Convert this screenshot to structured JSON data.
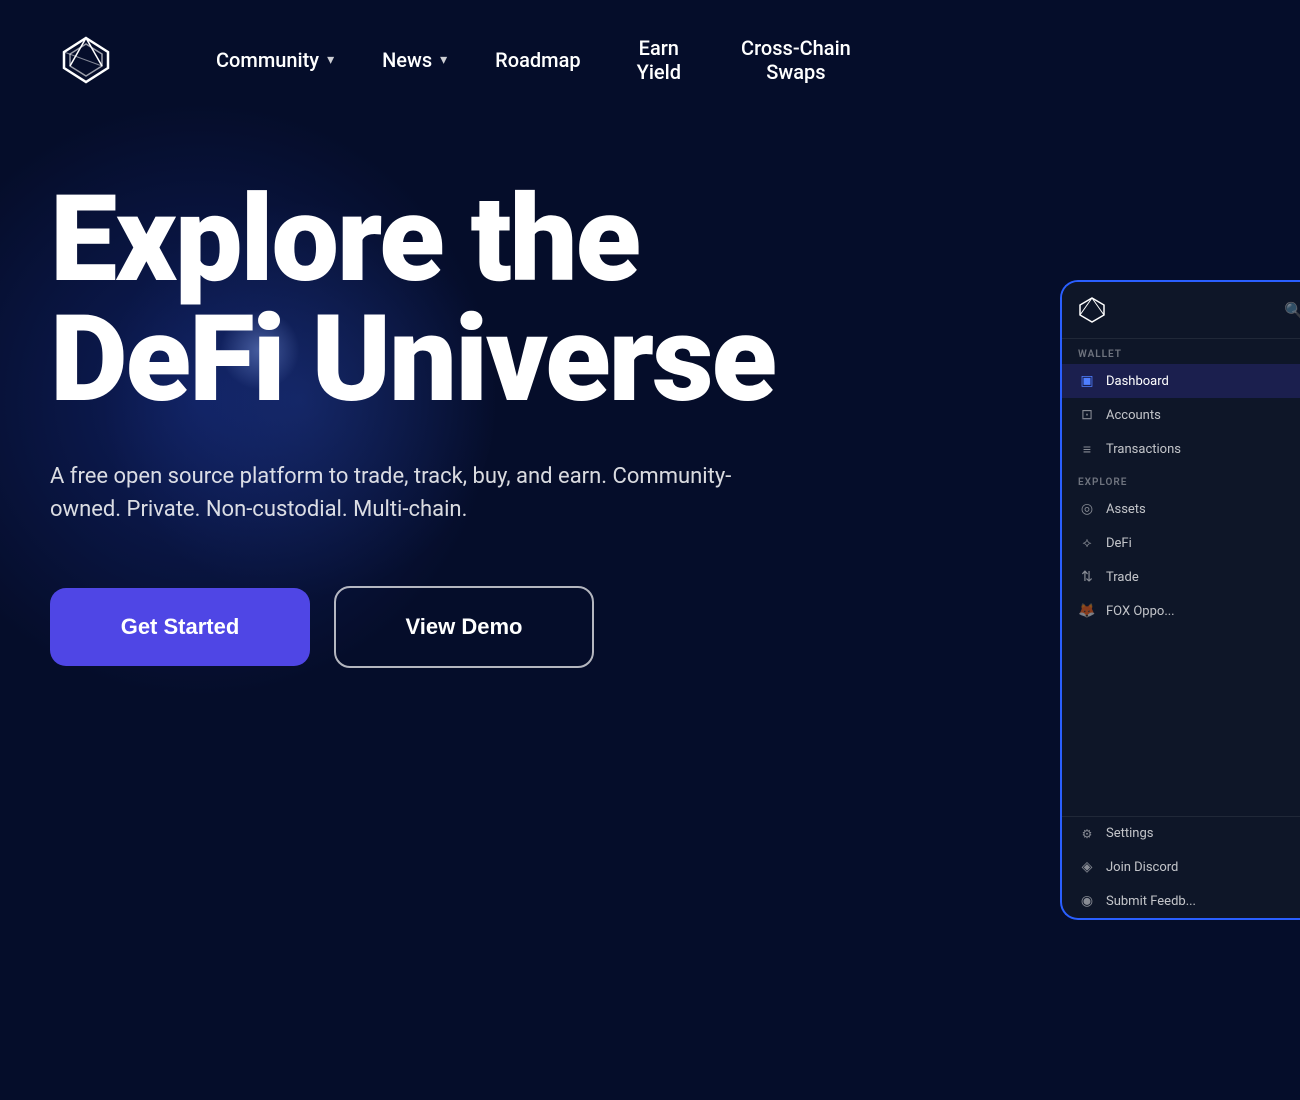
{
  "logo": {
    "alt": "ShapeShift Fox Logo"
  },
  "nav": {
    "items": [
      {
        "id": "community",
        "label": "Community",
        "hasDropdown": true
      },
      {
        "id": "news",
        "label": "News",
        "hasDropdown": true
      },
      {
        "id": "roadmap",
        "label": "Roadmap",
        "hasDropdown": false
      },
      {
        "id": "earn-yield",
        "label": "Earn\nYield",
        "hasDropdown": false
      },
      {
        "id": "cross-chain",
        "label": "Cross-Chain\nSwaps",
        "hasDropdown": false
      }
    ]
  },
  "hero": {
    "title_line1": "Explore the",
    "title_line2": "DeFi Universe",
    "subtitle": "A free open source platform to trade, track, buy, and earn. Community-owned. Private. Non-custodial. Multi-chain.",
    "btn_get_started": "Get Started",
    "btn_view_demo": "View Demo"
  },
  "app_preview": {
    "section_wallet": "WALLET",
    "section_explore": "EXPLORE",
    "menu_items_wallet": [
      {
        "id": "dashboard",
        "label": "Dashboard",
        "icon": "▣",
        "active": true
      },
      {
        "id": "accounts",
        "label": "Accounts",
        "icon": "⊡"
      },
      {
        "id": "transactions",
        "label": "Transactions",
        "icon": "≡"
      }
    ],
    "menu_items_explore": [
      {
        "id": "assets",
        "label": "Assets",
        "icon": "◎"
      },
      {
        "id": "defi",
        "label": "DeFi",
        "icon": "⟡"
      },
      {
        "id": "trade",
        "label": "Trade",
        "icon": "⇅"
      },
      {
        "id": "fox-oppo",
        "label": "FOX Oppo...",
        "icon": "🦊"
      }
    ],
    "menu_items_bottom": [
      {
        "id": "settings",
        "label": "Settings",
        "icon": "⚙"
      },
      {
        "id": "join-discord",
        "label": "Join Discord",
        "icon": "◈"
      },
      {
        "id": "submit-feedback",
        "label": "Submit Feedb...",
        "icon": "◉"
      }
    ]
  },
  "colors": {
    "accent_blue": "#4f46e5",
    "nav_bg": "#050d2a",
    "preview_border": "#2a5fff"
  }
}
